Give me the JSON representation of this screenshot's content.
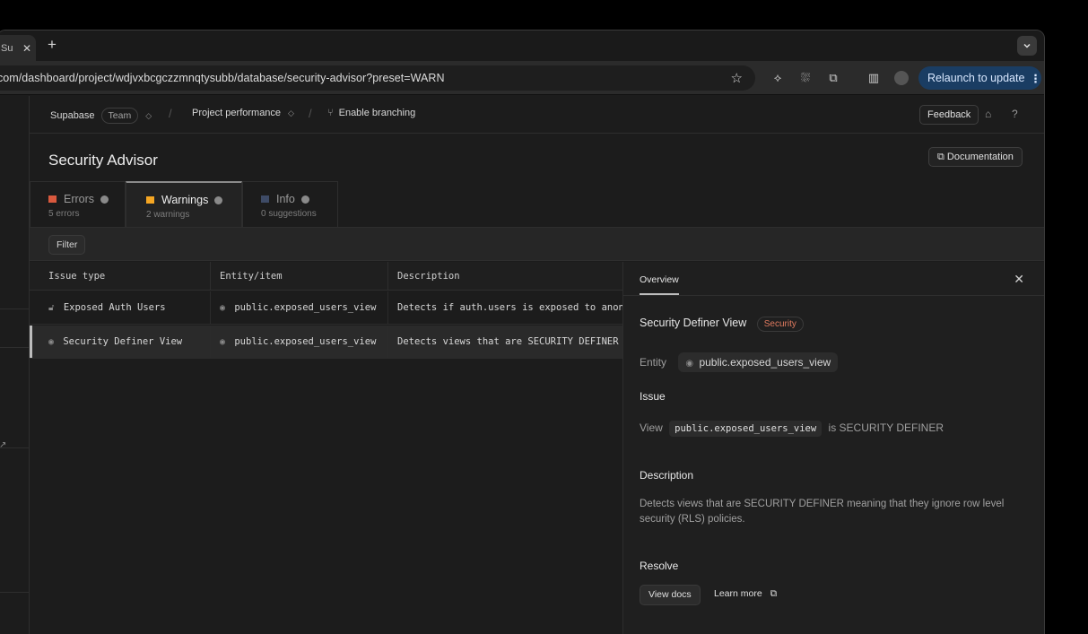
{
  "browser": {
    "tab_title": "Supabase",
    "new_tab": "+",
    "url": "com/dashboard/project/wdjvxbcgczzmnqtysubb/database/security-advisor?preset=WARN",
    "relaunch_label": "Relaunch to update"
  },
  "topbar": {
    "org": "Supabase",
    "org_badge": "Team",
    "project": "Project performance",
    "branching": "Enable branching",
    "feedback": "Feedback"
  },
  "page": {
    "title": "Security Advisor",
    "documentation": "Documentation"
  },
  "tabs": [
    {
      "label": "Errors",
      "sub": "5 errors",
      "color": "#e5533b"
    },
    {
      "label": "Warnings",
      "sub": "2 warnings",
      "color": "#f5a623"
    },
    {
      "label": "Info",
      "sub": "0 suggestions",
      "color": "#4a5a78"
    }
  ],
  "filter_label": "Filter",
  "table": {
    "headers": [
      "Issue type",
      "Entity/item",
      "Description"
    ],
    "rows": [
      {
        "issue": "Exposed Auth Users",
        "entity": "public.exposed_users_view",
        "description": "Detects if auth.users is exposed to anon"
      },
      {
        "issue": "Security Definer View",
        "entity": "public.exposed_users_view",
        "description": "Detects views that are SECURITY DEFINER m"
      }
    ]
  },
  "panel": {
    "tab": "Overview",
    "heading": "Security Definer View",
    "category": "Security",
    "entity_label": "Entity",
    "entity_value": "public.exposed_users_view",
    "issue_title": "Issue",
    "issue_prefix": "View",
    "issue_code": "public.exposed_users_view",
    "issue_suffix": "is SECURITY DEFINER",
    "description_title": "Description",
    "description_text": "Detects views that are SECURITY DEFINER meaning that they ignore row level security (RLS) policies.",
    "resolve_title": "Resolve",
    "view_docs": "View docs",
    "learn_more": "Learn more"
  }
}
